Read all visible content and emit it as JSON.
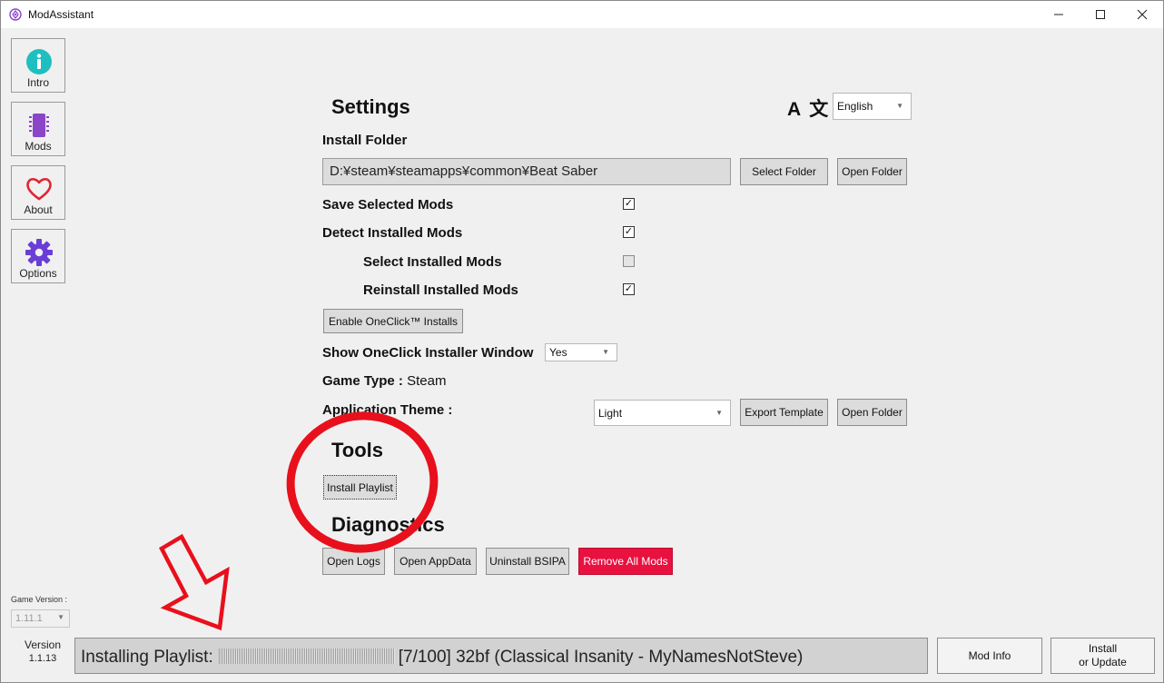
{
  "window": {
    "title": "ModAssistant",
    "colors": {
      "accent": "#e8113f",
      "intro": "#1fbfbf",
      "mods": "#8a45c9",
      "about": "#e02434",
      "options": "#6a3ed6"
    }
  },
  "sidebar": {
    "items": [
      {
        "label": "Intro",
        "icon": "info-icon"
      },
      {
        "label": "Mods",
        "icon": "chip-icon"
      },
      {
        "label": "About",
        "icon": "heart-icon"
      },
      {
        "label": "Options",
        "icon": "gear-icon"
      }
    ],
    "game_version_label": "Game Version :",
    "game_version_value": "1.11.1",
    "version_label": "Version",
    "version_value": "1.1.13"
  },
  "settings": {
    "title": "Settings",
    "language_icon": "A 文",
    "language_value": "English",
    "install_folder_label": "Install Folder",
    "install_folder_path": "D:¥steam¥steamapps¥common¥Beat Saber",
    "select_folder_label": "Select Folder",
    "open_folder_label": "Open Folder",
    "save_selected_mods_label": "Save Selected Mods",
    "save_selected_mods_checked": true,
    "detect_installed_mods_label": "Detect Installed Mods",
    "detect_installed_mods_checked": true,
    "select_installed_mods_label": "Select Installed Mods",
    "select_installed_mods_checked": false,
    "reinstall_installed_mods_label": "Reinstall Installed Mods",
    "reinstall_installed_mods_checked": true,
    "enable_oneclick_label": "Enable OneClick™ Installs",
    "show_oneclick_window_label": "Show OneClick Installer Window",
    "show_oneclick_window_value": "Yes",
    "game_type_label": "Game Type :",
    "game_type_value": "Steam",
    "application_theme_label": "Application Theme :",
    "application_theme_value": "Light",
    "export_template_label": "Export Template",
    "theme_open_folder_label": "Open Folder",
    "check_glyph": "✓"
  },
  "tools": {
    "title": "Tools",
    "install_playlist_label": "Install Playlist"
  },
  "diagnostics": {
    "title": "Diagnostics",
    "open_logs_label": "Open Logs",
    "open_appdata_label": "Open AppData",
    "uninstall_bsipa_label": "Uninstall BSIPA",
    "remove_all_mods_label": "Remove All Mods"
  },
  "status": {
    "prefix": "Installing Playlist:",
    "progress_text": "[7/100] 32bf (Classical Insanity - MyNamesNotSteve)",
    "progress_fraction": 1.0
  },
  "bottom": {
    "mod_info_label": "Mod Info",
    "install_line1": "Install",
    "install_line2": "or Update"
  }
}
